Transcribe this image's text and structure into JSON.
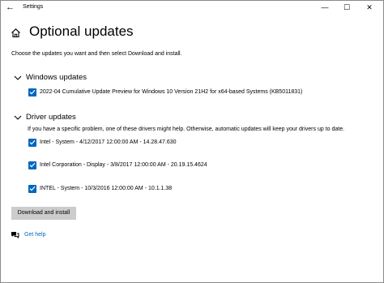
{
  "window": {
    "title": "Settings",
    "controls": {
      "minimize": "—",
      "maximize": "☐",
      "close": "✕"
    }
  },
  "page": {
    "title": "Optional updates",
    "intro": "Choose the updates you want and then select Download and install."
  },
  "windows_updates": {
    "label": "Windows updates",
    "items": [
      {
        "label": "2022-04 Cumulative Update Preview for Windows 10 Version 21H2 for x64-based Systems (KB5011831)",
        "checked": true
      }
    ]
  },
  "driver_updates": {
    "label": "Driver updates",
    "description": "If you have a specific problem, one of these drivers might help. Otherwise, automatic updates will keep your drivers up to date.",
    "items": [
      {
        "label": "Intel - System - 4/12/2017 12:00:00 AM - 14.28.47.630",
        "checked": true
      },
      {
        "label": "Intel Corporation - Display - 3/8/2017 12:00:00 AM - 20.19.15.4624",
        "checked": true
      },
      {
        "label": "INTEL - System - 10/3/2016 12:00:00 AM - 10.1.1.38",
        "checked": true
      }
    ]
  },
  "actions": {
    "download_install": "Download and install"
  },
  "help": {
    "label": "Get help"
  },
  "colors": {
    "accent": "#0067c0",
    "button_bg": "#cccccc"
  },
  "icons": [
    "back-arrow-icon",
    "home-icon",
    "chevron-down-icon",
    "checkmark-icon",
    "help-chat-icon"
  ]
}
